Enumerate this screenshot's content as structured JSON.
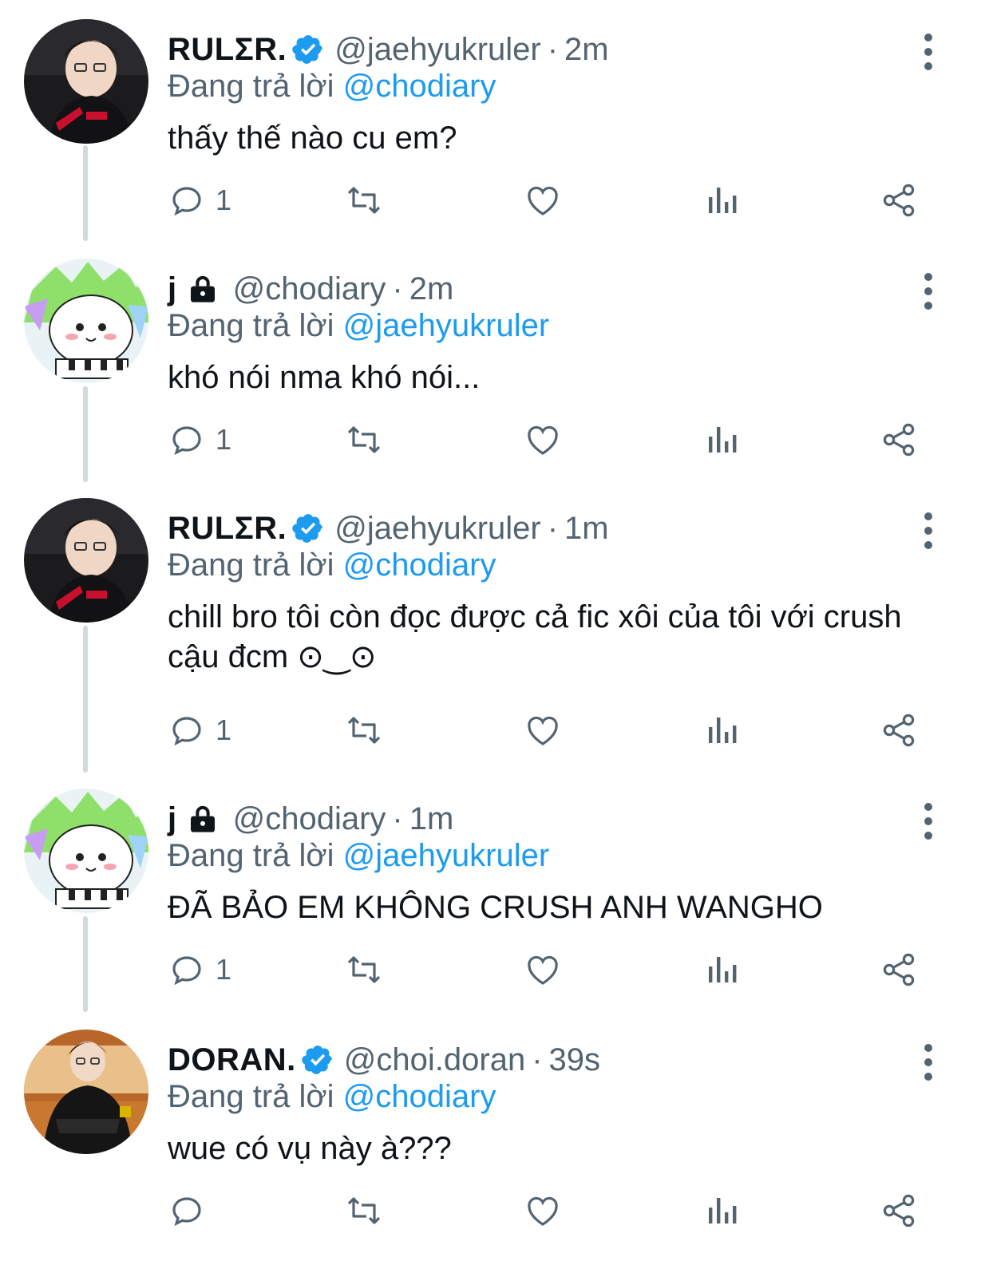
{
  "tweets": [
    {
      "name": "RULΣR.",
      "verified": true,
      "protected": false,
      "handle": "@jaehyukruler",
      "time": "2m",
      "reply_prefix": "Đang trả lời ",
      "reply_to": "@chodiary",
      "text": "thấy thế nào cu em?",
      "reply_count": "1",
      "avatar": "ruler-avatar"
    },
    {
      "name": "j",
      "verified": false,
      "protected": true,
      "handle": "@chodiary",
      "time": "2m",
      "reply_prefix": "Đang trả lời ",
      "reply_to": "@jaehyukruler",
      "text": "khó nói nma khó nói...",
      "reply_count": "1",
      "avatar": "hamster-avatar"
    },
    {
      "name": "RULΣR.",
      "verified": true,
      "protected": false,
      "handle": "@jaehyukruler",
      "time": "1m",
      "reply_prefix": "Đang trả lời ",
      "reply_to": "@chodiary",
      "text": "chill bro tôi còn đọc được cả fic xôi của tôi với crush cậu đcm ⊙‿⊙",
      "reply_count": "1",
      "avatar": "ruler-avatar"
    },
    {
      "name": "j",
      "verified": false,
      "protected": true,
      "handle": "@chodiary",
      "time": "1m",
      "reply_prefix": "Đang trả lời ",
      "reply_to": "@jaehyukruler",
      "text": "ĐÃ BẢO EM KHÔNG CRUSH ANH WANGHO",
      "reply_count": "1",
      "avatar": "hamster-avatar"
    },
    {
      "name": "DORAN.",
      "verified": true,
      "protected": false,
      "handle": "@choi.doran",
      "time": "39s",
      "reply_prefix": "Đang trả lời ",
      "reply_to": "@chodiary",
      "text": "wue có vụ này à???",
      "reply_count": "",
      "avatar": "doran-avatar"
    }
  ],
  "separator": "·",
  "colors": {
    "accent": "#1d9bf0",
    "secondary_text": "#536471",
    "primary_text": "#0f1419",
    "thread_line": "#cfd9de"
  },
  "icons": {
    "reply": "reply-icon",
    "retweet": "retweet-icon",
    "like": "heart-icon",
    "views": "views-chart-icon",
    "share": "share-icon",
    "more": "more-vertical-icon",
    "verified": "verified-badge-icon",
    "protected": "lock-icon"
  }
}
